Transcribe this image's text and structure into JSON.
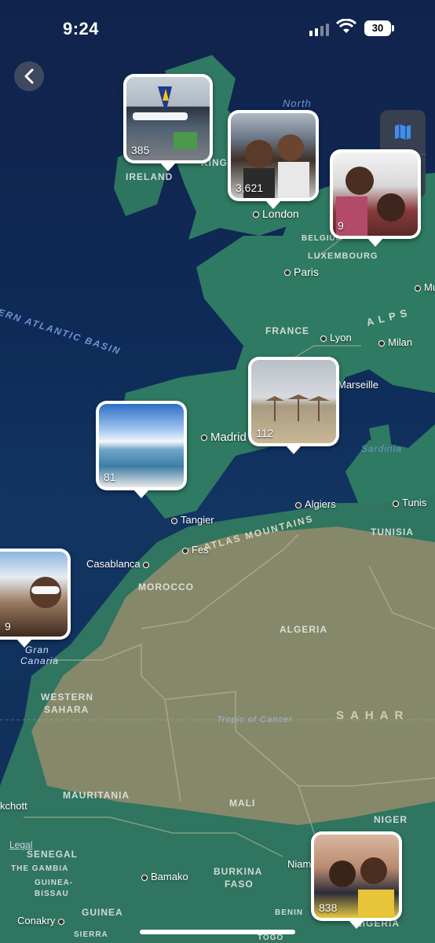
{
  "status_bar": {
    "time": "9:24",
    "battery": "30"
  },
  "map_labels": {
    "cities": [
      "London",
      "Paris",
      "Lyon",
      "Milan",
      "Marseille",
      "Madrid",
      "Tangier",
      "Fes",
      "Casablanca",
      "Algiers",
      "Tunis",
      "Bamako",
      "Niam",
      "kchott",
      "Conakry",
      "Mu"
    ],
    "countries": [
      "IRELAND",
      "KING",
      "BELGIUM",
      "LUXEMBOURG",
      "FRANCE",
      "MOROCCO",
      "ALGERIA",
      "TUNISIA",
      "WESTERN",
      "SAHARA",
      "MAURITANIA",
      "MALI",
      "NIGER",
      "SENEGAL",
      "THE GAMBIA",
      "GUINEA-",
      "BISSAU",
      "GUINEA",
      "BURKINA",
      "FASO",
      "BENIN",
      "NIGERIA",
      "SIERRA",
      "TOGO",
      "SAHAR",
      "ALPS"
    ],
    "water": [
      "North",
      "ERN ATLANTIC BASIN",
      "Sardinia",
      "ATLAS MOUNTAINS",
      "Tropic of Cancer",
      "Gran",
      "Canaria"
    ]
  },
  "pins": [
    {
      "name": "pin-ireland",
      "count": "385"
    },
    {
      "name": "pin-london",
      "count": "3,621"
    },
    {
      "name": "pin-belgium",
      "count": "9"
    },
    {
      "name": "pin-marseille",
      "count": "112"
    },
    {
      "name": "pin-portugal",
      "count": "81"
    },
    {
      "name": "pin-canary",
      "count": "9"
    },
    {
      "name": "pin-nigeria",
      "count": "838"
    }
  ],
  "legal": "Legal",
  "colors": {
    "ocean": "#10234c",
    "land_green": "#2e7a62",
    "desert": "#8a8a6a",
    "pin_border": "#ffffff"
  }
}
